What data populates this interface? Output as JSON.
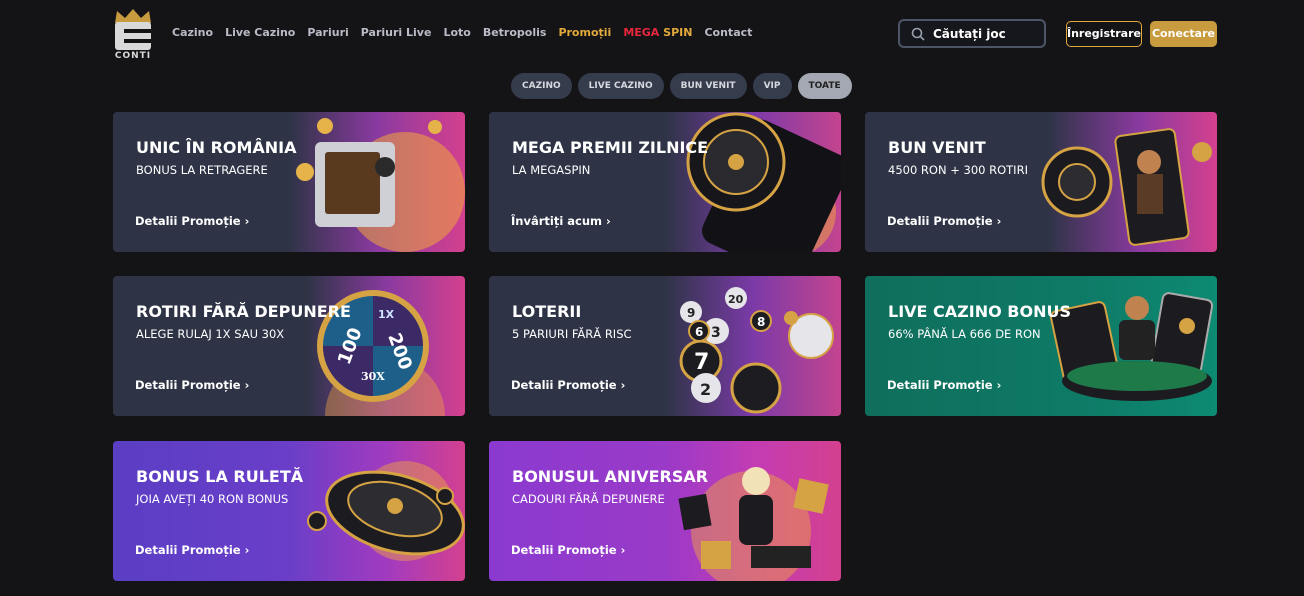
{
  "brand": {
    "name": "CONTI"
  },
  "nav": {
    "items": [
      "Cazino",
      "Live Cazino",
      "Pariuri",
      "Pariuri Live",
      "Loto",
      "Betropolis",
      "Promoții"
    ],
    "mega_part1": "MEGA",
    "mega_part2": "SPIN",
    "contact": "Contact"
  },
  "search": {
    "placeholder": "Căutați joc"
  },
  "auth": {
    "register": "Înregistrare",
    "login": "Conectare"
  },
  "filters": [
    "CAZINO",
    "LIVE CAZINO",
    "BUN VENIT",
    "VIP",
    "TOATE"
  ],
  "selected_filter": "TOATE",
  "promos": [
    {
      "title": "UNIC ÎN ROMÂNIA",
      "subtitle": "BONUS LA RETRAGERE",
      "cta": "Detalii Promoție",
      "icon": "safe-icon"
    },
    {
      "title": "MEGA PREMII ZILNICE",
      "subtitle": "LA MEGASPIN",
      "cta": "Învârtiți acum",
      "icon": "spin-wheel-icon"
    },
    {
      "title": "BUN VENIT",
      "subtitle": "4500 RON + 300 ROTIRI",
      "cta": "Detalii Promoție",
      "icon": "joker-card-icon"
    },
    {
      "title": "ROTIRI FĂRĂ DEPUNERE",
      "subtitle": "ALEGE RULAJ 1X SAU 30X",
      "cta": "Detalii Promoție",
      "icon": "wheel-icon",
      "wheel_labels": [
        "1X",
        "100",
        "200",
        "30X"
      ]
    },
    {
      "title": "LOTERII",
      "subtitle": "5 PARIURI FĂRĂ RISC",
      "cta": "Detalii Promoție",
      "icon": "lottery-balls-icon",
      "ball_labels": [
        "7",
        "3",
        "20",
        "9",
        "6",
        "2",
        "8"
      ]
    },
    {
      "title": "LIVE CAZINO BONUS",
      "subtitle": "66% PÂNĂ LA 666 DE RON",
      "cta": "Detalii Promoție",
      "icon": "dealer-table-icon"
    },
    {
      "title": "BONUS LA RULETĂ",
      "subtitle": "JOIA AVEȚI 40 RON BONUS",
      "cta": "Detalii Promoție",
      "icon": "roulette-icon"
    },
    {
      "title": "BONUSUL ANIVERSAR",
      "subtitle": "CADOURI FĂRĂ DEPUNERE",
      "cta": "Detalii Promoție",
      "icon": "gift-icon"
    }
  ],
  "colors": {
    "accent_gold": "#c99b3f",
    "active_nav": "#e2a93b",
    "mega_red": "#e8273d",
    "page_bg": "#141417"
  }
}
